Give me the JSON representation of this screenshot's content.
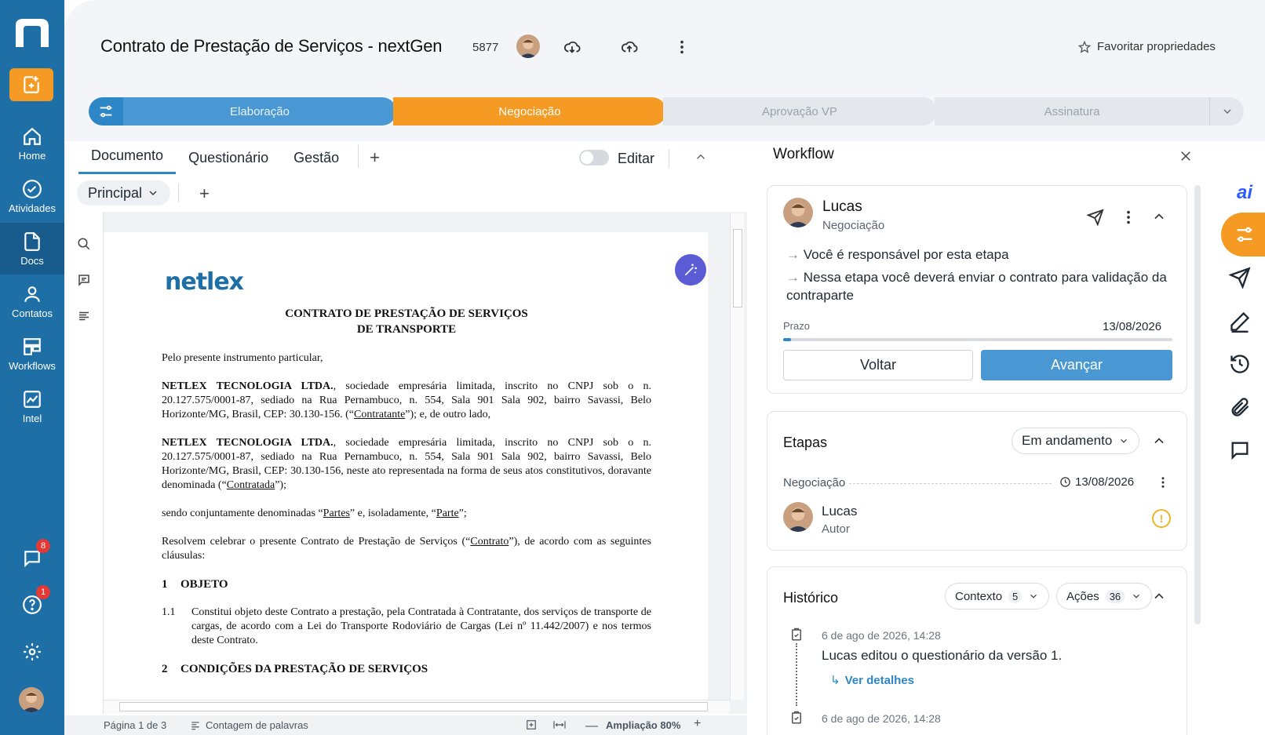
{
  "nav": {
    "items": [
      {
        "label": "Home"
      },
      {
        "label": "Atividades"
      },
      {
        "label": "Docs"
      },
      {
        "label": "Contatos"
      },
      {
        "label": "Workflows"
      },
      {
        "label": "Intel"
      }
    ],
    "chat_badge": "8",
    "help_badge": "1"
  },
  "header": {
    "title": "Contrato de Prestação de Serviços - nextGen",
    "code": "5877",
    "favorite_label": "Favoritar propriedades"
  },
  "stepper": {
    "steps": [
      "Elaboração",
      "Negociação",
      "Aprovação VP",
      "Assinatura"
    ],
    "active_index": 1
  },
  "tabs": {
    "items": [
      "Documento",
      "Questionário",
      "Gestão"
    ],
    "edit_label": "Editar",
    "version_label": "Principal"
  },
  "document": {
    "logo": "netlex",
    "title_line1": "CONTRATO DE PRESTAÇÃO DE SERVIÇOS",
    "title_line2": "DE TRANSPORTE",
    "intro": "Pelo presente instrumento particular,",
    "party1_name": "NETLEX TECNOLOGIA LTDA.",
    "party1_text": ", sociedade empresária limitada, inscrito no CNPJ sob o n. 20.127.575/0001-87, sediado na Rua Pernambuco, n. 554, Sala 901 Sala 902, bairro Savassi, Belo Horizonte/MG, Brasil, CEP: 30.130-156. (“",
    "party1_role": "Contratante",
    "party1_end": "”); e, de outro lado,",
    "party2_name": "NETLEX TECNOLOGIA LTDA.",
    "party2_text": ", sociedade empresária limitada, inscrito no CNPJ sob o n. 20.127.575/0001-87, sediado na Rua Pernambuco, n. 554, Sala 901 Sala 902, bairro Savassi, Belo Horizonte/MG, Brasil, CEP: 30.130-156, neste ato representada na forma de seus atos constitutivos, doravante denominada (“",
    "party2_role": "Contratada",
    "party2_end": "”);",
    "jointly_pre": "sendo conjuntamente denominadas “",
    "jointly_partes": "Partes",
    "jointly_mid": "” e, isoladamente, “",
    "jointly_parte": "Parte",
    "jointly_end": "”;",
    "resolve_pre": "Resolvem celebrar o presente Contrato de Prestação de Serviços (“",
    "resolve_contrato": "Contrato",
    "resolve_end": "”), de acordo com as seguintes cláusulas:",
    "sec1_num": "1",
    "sec1_title": "OBJETO",
    "item11_num": "1.1",
    "item11_text": "Constitui objeto deste Contrato a prestação, pela Contratada à Contratante, dos serviços de transporte de cargas, de acordo com a Lei do Transporte Rodoviário de Cargas (Lei nº 11.442/2007) e nos termos deste Contrato.",
    "sec2_num": "2",
    "sec2_title": "CONDIÇÕES DA PRESTAÇÃO DE SERVIÇOS"
  },
  "statusbar": {
    "page": "Página 1 de 3",
    "word_count": "Contagem de palavras",
    "zoom": "Ampliação 80%"
  },
  "workflow": {
    "title": "Workflow",
    "current": {
      "name": "Lucas",
      "stage": "Negociação",
      "line1": "Você é responsável por esta etapa",
      "line2": "Nessa etapa você deverá enviar o contrato para validação da contraparte",
      "prazo_label": "Prazo",
      "prazo_date": "13/08/2026",
      "progress": 0.02,
      "back_label": "Voltar",
      "next_label": "Avançar"
    },
    "etapas": {
      "title": "Etapas",
      "filter": "Em andamento",
      "row_label": "Negociação",
      "row_date": "13/08/2026",
      "person_name": "Lucas",
      "person_role": "Autor"
    },
    "historico": {
      "title": "Histórico",
      "contexto_label": "Contexto",
      "contexto_count": "5",
      "acoes_label": "Ações",
      "acoes_count": "36",
      "entries": [
        {
          "date": "6 de ago de 2026, 14:28",
          "text": "Lucas editou o questionário da versão 1.",
          "link": "Ver detalhes"
        },
        {
          "date": "6 de ago de 2026, 14:28"
        }
      ]
    }
  },
  "rail": {
    "ai_label": "ai"
  },
  "colors": {
    "nav": "#1e6fa5",
    "accent": "#f59a23",
    "primary": "#4a98d3"
  }
}
